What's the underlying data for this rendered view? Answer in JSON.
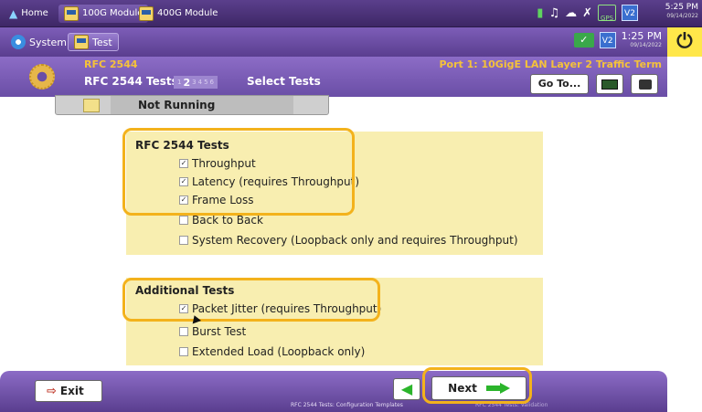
{
  "topbar": {
    "tabs": [
      {
        "label": "Home",
        "icon": "home-icon"
      },
      {
        "label": "100G Module",
        "icon": "module-icon"
      },
      {
        "label": "400G Module",
        "icon": "module-icon"
      }
    ],
    "time": "5:25 PM",
    "date": "09/14/2022",
    "gps_label": "GPS",
    "v2_label": "V2"
  },
  "secbar": {
    "tabs": [
      {
        "label": "System",
        "icon": "gear-icon"
      },
      {
        "label": "Test",
        "icon": "module-icon"
      }
    ],
    "time": "1:25 PM",
    "date": "09/14/2022",
    "v2_label": "V2"
  },
  "header": {
    "test_name": "RFC 2544",
    "port": "Port 1: 10GigE LAN Layer 2 Traffic Term",
    "title": "RFC 2544 Tests",
    "current_step": "2",
    "steps": [
      "1",
      "2",
      "3",
      "4",
      "5",
      "6"
    ],
    "step_title": "Select Tests",
    "goto_label": "Go To..."
  },
  "status": {
    "text": "Not Running"
  },
  "rfc_panel": {
    "title": "RFC 2544 Tests",
    "options": [
      {
        "label": "Throughput",
        "checked": true
      },
      {
        "label": "Latency (requires Throughput)",
        "checked": true
      },
      {
        "label": "Frame Loss",
        "checked": true
      },
      {
        "label": "Back to Back",
        "checked": false
      },
      {
        "label": "System Recovery (Loopback only and requires Throughput)",
        "checked": false
      }
    ]
  },
  "additional_panel": {
    "title": "Additional Tests",
    "options": [
      {
        "label": "Packet Jitter (requires Throughput)",
        "checked": true
      },
      {
        "label": "Burst Test",
        "checked": false
      },
      {
        "label": "Extended Load (Loopback only)",
        "checked": false
      }
    ]
  },
  "bottom": {
    "exit_label": "Exit",
    "next_label": "Next",
    "breadcrumb": "RFC 2544 Tests: Configuration Templates",
    "breadcrumb_next": "RFC 2544 Tests: Validation"
  },
  "colors": {
    "highlight": "#f3b21c",
    "panel": "#f8eeb0",
    "purple": "#6a4ea6",
    "accent_yellow": "#f5c23a"
  }
}
